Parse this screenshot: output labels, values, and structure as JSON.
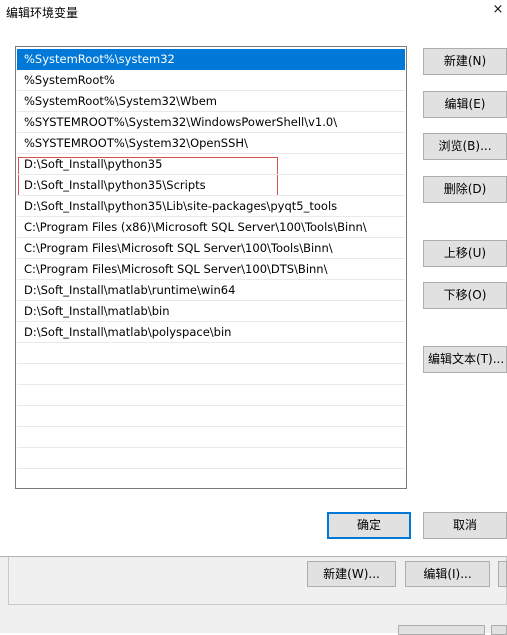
{
  "window": {
    "title": "编辑环境变量",
    "close_glyph": "×"
  },
  "list": {
    "items": [
      {
        "text": "%SystemRoot%\\system32",
        "selected": true
      },
      {
        "text": "%SystemRoot%",
        "selected": false
      },
      {
        "text": "%SystemRoot%\\System32\\Wbem",
        "selected": false
      },
      {
        "text": "%SYSTEMROOT%\\System32\\WindowsPowerShell\\v1.0\\",
        "selected": false
      },
      {
        "text": "%SYSTEMROOT%\\System32\\OpenSSH\\",
        "selected": false
      },
      {
        "text": "D:\\Soft_Install\\python35",
        "selected": false
      },
      {
        "text": "D:\\Soft_Install\\python35\\Scripts",
        "selected": false
      },
      {
        "text": "D:\\Soft_Install\\python35\\Lib\\site-packages\\pyqt5_tools",
        "selected": false
      },
      {
        "text": "C:\\Program Files (x86)\\Microsoft SQL Server\\100\\Tools\\Binn\\",
        "selected": false
      },
      {
        "text": "C:\\Program Files\\Microsoft SQL Server\\100\\Tools\\Binn\\",
        "selected": false
      },
      {
        "text": "C:\\Program Files\\Microsoft SQL Server\\100\\DTS\\Binn\\",
        "selected": false
      },
      {
        "text": "D:\\Soft_Install\\matlab\\runtime\\win64",
        "selected": false
      },
      {
        "text": "D:\\Soft_Install\\matlab\\bin",
        "selected": false
      },
      {
        "text": "D:\\Soft_Install\\matlab\\polyspace\\bin",
        "selected": false
      }
    ],
    "selection_color": "#0078d7",
    "highlight_color": "#d9534f"
  },
  "side_buttons": {
    "new": "新建(N)",
    "edit": "编辑(E)",
    "browse": "浏览(B)...",
    "delete": "删除(D)",
    "move_up": "上移(U)",
    "move_down": "下移(O)",
    "edit_text": "编辑文本(T)..."
  },
  "footer": {
    "ok": "确定",
    "cancel": "取消"
  },
  "underlying_dialog": {
    "new": "新建(W)...",
    "edit": "编辑(I)..."
  }
}
